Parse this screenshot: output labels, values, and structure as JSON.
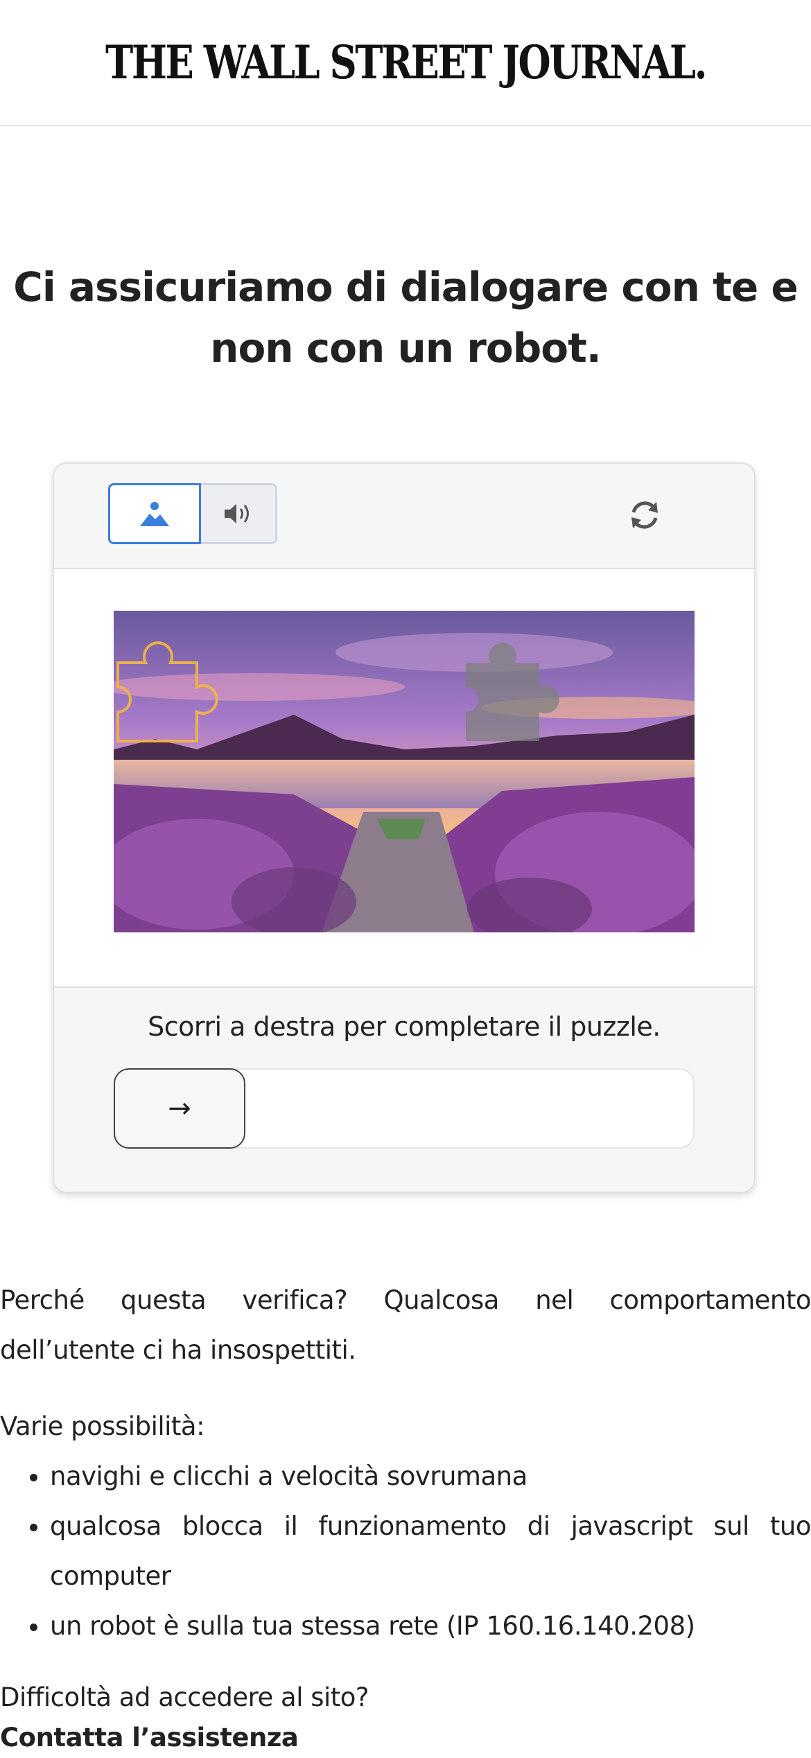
{
  "header": {
    "logo_text": "THE WALL STREET JOURNAL."
  },
  "headline": {
    "line1": "Ci assicuriamo di dialogare con te e",
    "line2": "non con un robot."
  },
  "captcha": {
    "tabs": [
      {
        "icon": "image-icon",
        "selected": true
      },
      {
        "icon": "speaker-icon",
        "selected": false
      }
    ],
    "refresh_icon": "refresh-icon",
    "instruction": "Scorri a destra per completare il puzzle.",
    "slider_icon": "arrow-right-icon",
    "slider_arrow": "→",
    "slider_progress": 0,
    "accent_color": "#3b7ddd"
  },
  "info": {
    "why_line1": "Perché questa verifica? Qualcosa nel comportamento",
    "why_line2": "dell’utente ci ha insospettiti.",
    "reasons_title": "Varie possibilità:",
    "reasons": [
      "navighi e clicchi a velocità sovrumana",
      "qualcosa blocca il funzionamento di javascript sul tuo computer",
      "un robot è sulla tua stessa rete (IP 160.16.140.208)"
    ],
    "help_question": "Difficoltà ad accedere al sito?",
    "help_link": "Contatta l’assistenza"
  }
}
